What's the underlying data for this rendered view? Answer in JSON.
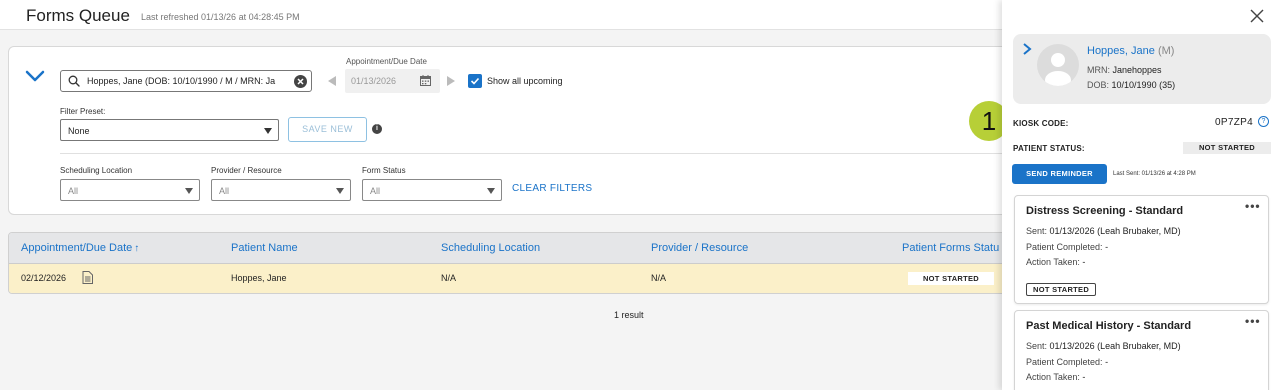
{
  "header": {
    "title": "Forms Queue",
    "refreshed": "Last refreshed 01/13/26 at 04:28:45 PM"
  },
  "filters": {
    "search_value": "Hoppes, Jane (DOB: 10/10/1990 / M / MRN: Ja",
    "date_label": "Appointment/Due Date",
    "date_value": "01/13/2026",
    "show_upcoming_label": "Show all upcoming",
    "show_upcoming_checked": true,
    "preset_label": "Filter Preset:",
    "preset_value": "None",
    "save_new_label": "SAVE NEW",
    "scheduling_location_label": "Scheduling Location",
    "scheduling_location_value": "All",
    "provider_label": "Provider / Resource",
    "provider_value": "All",
    "form_status_label": "Form Status",
    "form_status_value": "All",
    "clear_filters_label": "CLEAR FILTERS"
  },
  "table": {
    "columns": [
      "Appointment/Due Date",
      "Patient Name",
      "Scheduling Location",
      "Provider / Resource",
      "Patient Forms Statu"
    ],
    "sort_arrow": "↑",
    "rows": [
      {
        "date": "02/12/2026",
        "patient": "Hoppes, Jane",
        "location": "N/A",
        "provider": "N/A",
        "status": "NOT STARTED"
      }
    ],
    "result_count": "1 result"
  },
  "panel": {
    "patient_name": "Hoppes, Jane",
    "patient_sex": "(M)",
    "mrn_label": "MRN:",
    "mrn_value": "Janehoppes",
    "dob_label": "DOB:",
    "dob_value": "10/10/1990 (35)",
    "step_number": "1",
    "kiosk_label": "KIOSK CODE:",
    "kiosk_value": "0P7ZP4",
    "patient_status_label": "PATIENT STATUS:",
    "patient_status_value": "NOT STARTED",
    "send_reminder_label": "SEND REMINDER",
    "last_sent": "Last Sent: 01/13/26 at 4:28 PM",
    "forms": [
      {
        "title": "Distress Screening - Standard",
        "sent_label": "Sent:",
        "sent_value": "01/13/2026 (Leah Brubaker, MD)",
        "completed_label": "Patient Completed:",
        "completed_value": "-",
        "action_label": "Action Taken:",
        "action_value": "-",
        "status": "NOT STARTED"
      },
      {
        "title": "Past Medical History - Standard",
        "sent_label": "Sent:",
        "sent_value": "01/13/2026 (Leah Brubaker, MD)",
        "completed_label": "Patient Completed:",
        "completed_value": "-",
        "action_label": "Action Taken:",
        "action_value": "-"
      }
    ]
  },
  "colors": {
    "accent": "#1a73c8",
    "row_highlight": "#fbf0c9",
    "step_badge": "#b7cf37"
  },
  "icons": [
    "chevron-down-icon",
    "search-icon",
    "clear-icon",
    "calendar-icon",
    "checkbox-check-icon",
    "info-icon",
    "document-icon",
    "close-icon",
    "chevron-right-icon",
    "avatar-icon",
    "help-icon",
    "more-icon"
  ]
}
